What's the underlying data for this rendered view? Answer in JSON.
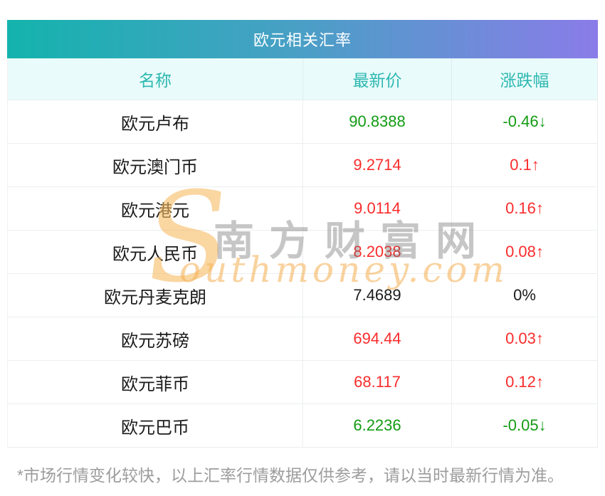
{
  "header": {
    "title": "欧元相关汇率"
  },
  "table": {
    "columns": [
      {
        "label": "名称"
      },
      {
        "label": "最新价"
      },
      {
        "label": "涨跌幅"
      }
    ],
    "rows": [
      {
        "name": "欧元卢布",
        "price": "90.8388",
        "change": "-0.46↓",
        "trend": "down"
      },
      {
        "name": "欧元澳门币",
        "price": "9.2714",
        "change": "0.1↑",
        "trend": "up"
      },
      {
        "name": "欧元港元",
        "price": "9.0114",
        "change": "0.16↑",
        "trend": "up"
      },
      {
        "name": "欧元人民币",
        "price": "8.2038",
        "change": "0.08↑",
        "trend": "up"
      },
      {
        "name": "欧元丹麦克朗",
        "price": "7.4689",
        "change": "0%",
        "trend": "flat"
      },
      {
        "name": "欧元苏磅",
        "price": "694.44",
        "change": "0.03↑",
        "trend": "up"
      },
      {
        "name": "欧元菲币",
        "price": "68.117",
        "change": "0.12↑",
        "trend": "up"
      },
      {
        "name": "欧元巴币",
        "price": "6.2236",
        "change": "-0.05↓",
        "trend": "down"
      }
    ]
  },
  "watermark": {
    "swoosh": "S",
    "cn_text": "南方财富网",
    "en_text": "outhmoney.com"
  },
  "footnote": "*市场行情变化较快，以上汇率行情数据仅供参考，请以当时最新行情为准。",
  "colors": {
    "up_red": "#fa2c2c",
    "down_green": "#139b13",
    "neutral_black": "#1b1b1b",
    "header_gradient_left": "#14b3ad",
    "header_gradient_right": "#8a7ce8",
    "column_header_bg": "#e9fbfa",
    "column_header_text": "#2eb8b2",
    "watermark_orange": "#f5b964"
  }
}
